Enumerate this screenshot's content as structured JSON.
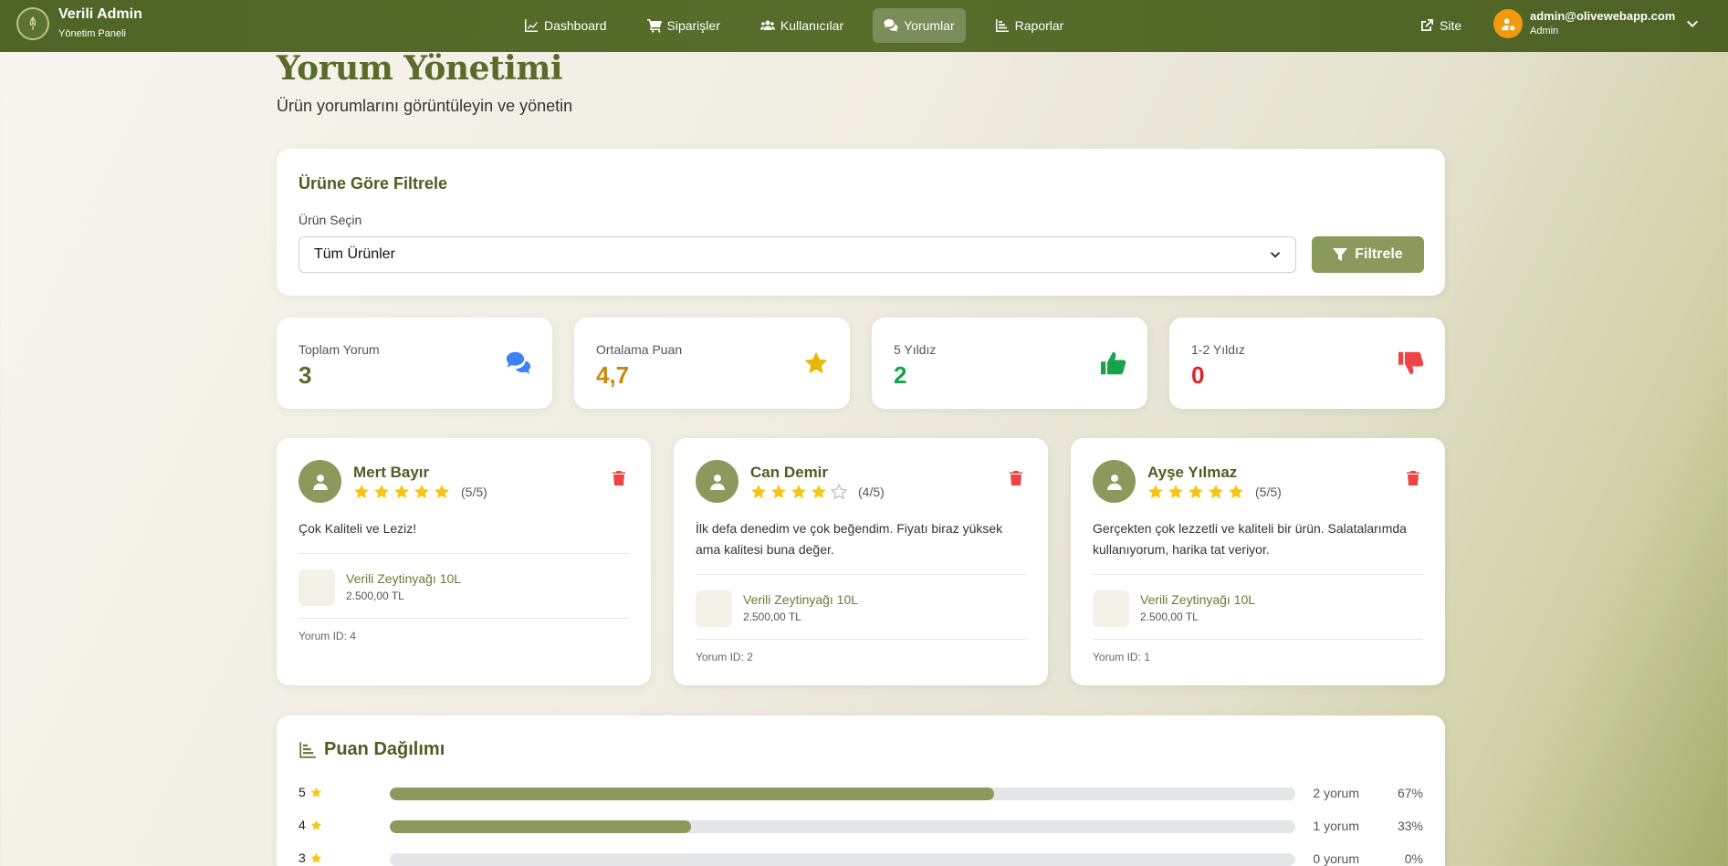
{
  "navbar": {
    "brand_title": "Verili Admin",
    "brand_subtitle": "Yönetim Paneli",
    "links": [
      {
        "label": "Dashboard",
        "icon": "chart-line-icon",
        "active": false
      },
      {
        "label": "Siparişler",
        "icon": "cart-icon",
        "active": false
      },
      {
        "label": "Kullanıcılar",
        "icon": "users-icon",
        "active": false
      },
      {
        "label": "Yorumlar",
        "icon": "comments-icon",
        "active": true
      },
      {
        "label": "Raporlar",
        "icon": "bar-chart-icon",
        "active": false
      }
    ],
    "site_label": "Site",
    "user": {
      "email": "admin@olivewebapp.com",
      "role": "Admin"
    }
  },
  "page": {
    "title": "Yorum Yönetimi",
    "subtitle": "Ürün yorumlarını görüntüleyin ve yönetin"
  },
  "filter": {
    "title": "Ürüne Göre Filtrele",
    "label": "Ürün Seçin",
    "selected": "Tüm Ürünler",
    "button": "Filtrele"
  },
  "stats": [
    {
      "label": "Toplam Yorum",
      "value": "3",
      "color": "#5a6b2a",
      "icon": "comments-icon",
      "icon_color": "#3b82f6"
    },
    {
      "label": "Ortalama Puan",
      "value": "4,7",
      "color": "#c98a10",
      "icon": "star-icon",
      "icon_color": "#e6b800"
    },
    {
      "label": "5 Yıldız",
      "value": "2",
      "color": "#16a34a",
      "icon": "thumbs-up-icon",
      "icon_color": "#16a34a"
    },
    {
      "label": "1-2 Yıldız",
      "value": "0",
      "color": "#dc2626",
      "icon": "thumbs-down-icon",
      "icon_color": "#ef4444"
    }
  ],
  "reviews": [
    {
      "name": "Mert Bayır",
      "rating": 5,
      "score": "(5/5)",
      "comment": "Çok Kaliteli ve Leziz!",
      "product": "Verili Zeytinyağı 10L",
      "price": "2.500,00 TL",
      "id_label": "Yorum ID: 4"
    },
    {
      "name": "Can Demir",
      "rating": 4,
      "score": "(4/5)",
      "comment": "İlk defa denedim ve çok beğendim. Fiyatı biraz yüksek ama kalitesi buna değer.",
      "product": "Verili Zeytinyağı 10L",
      "price": "2.500,00 TL",
      "id_label": "Yorum ID: 2"
    },
    {
      "name": "Ayşe Yılmaz",
      "rating": 5,
      "score": "(5/5)",
      "comment": "Gerçekten çok lezzetli ve kaliteli bir ürün. Salatalarımda kullanıyorum, harika tat veriyor.",
      "product": "Verili Zeytinyağı 10L",
      "price": "2.500,00 TL",
      "id_label": "Yorum ID: 1"
    }
  ],
  "distribution": {
    "title": "Puan Dağılımı",
    "rows": [
      {
        "star": "5",
        "count": "2 yorum",
        "percent_label": "67%",
        "fraction": 0.667
      },
      {
        "star": "4",
        "count": "1 yorum",
        "percent_label": "33%",
        "fraction": 0.333
      },
      {
        "star": "3",
        "count": "0 yorum",
        "percent_label": "0%",
        "fraction": 0
      }
    ]
  },
  "colors": {
    "brand": "#566d2b",
    "accent": "#8a9a5c",
    "star": "#f5c518",
    "delete": "#ef4444"
  }
}
